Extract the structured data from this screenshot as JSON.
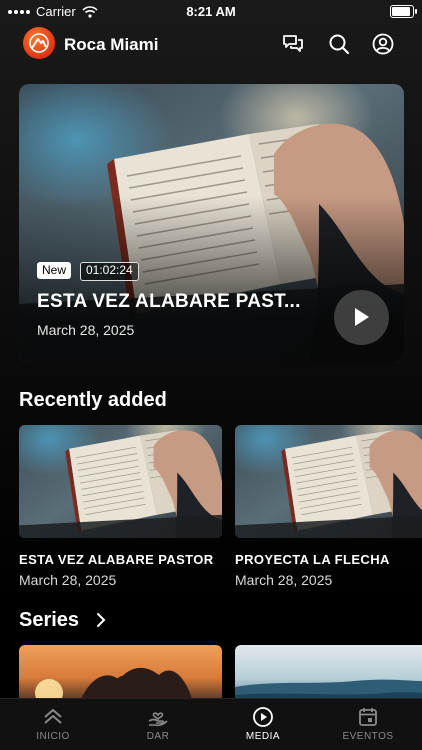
{
  "status_bar": {
    "carrier": "Carrier",
    "time": "8:21 AM"
  },
  "header": {
    "brand": "Roca Miami"
  },
  "hero": {
    "badge_new": "New",
    "duration": "01:02:24",
    "title": "ESTA VEZ ALABARE PAST...",
    "date": "March 28, 2025"
  },
  "recent": {
    "heading": "Recently added",
    "items": [
      {
        "title": "ESTA VEZ ALABARE PASTOR",
        "date": "March 28, 2025"
      },
      {
        "title": "PROYECTA LA FLECHA",
        "date": "March 28, 2025"
      }
    ]
  },
  "series": {
    "heading": "Series"
  },
  "tabs": [
    {
      "label": "INICIO",
      "icon": "home-chevrons-icon"
    },
    {
      "label": "DAR",
      "icon": "give-hand-icon"
    },
    {
      "label": "MEDIA",
      "icon": "play-circle-icon",
      "active": true
    },
    {
      "label": "EVENTOS",
      "icon": "calendar-icon"
    }
  ],
  "colors": {
    "brand_orange": "#e0331a",
    "background": "#000000",
    "tab_inactive": "#8a8a8a"
  }
}
